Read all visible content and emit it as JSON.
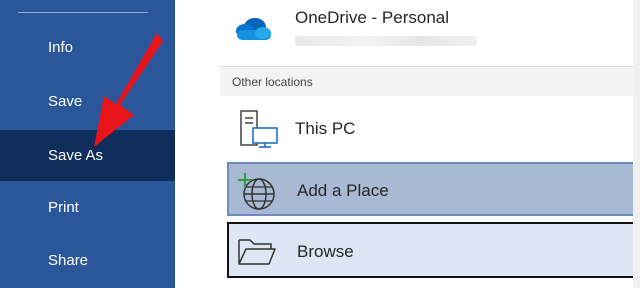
{
  "sidebar": {
    "items": [
      {
        "label": "Info"
      },
      {
        "label": "Save"
      },
      {
        "label": "Save As",
        "selected": true
      },
      {
        "label": "Print"
      },
      {
        "label": "Share"
      }
    ],
    "background": "#2b579a",
    "selected_background": "#0f2e5c"
  },
  "onedrive": {
    "title": "OneDrive - Personal",
    "icon": "onedrive-cloud-icon"
  },
  "other_locations": {
    "header": "Other locations",
    "items": [
      {
        "label": "This PC",
        "icon": "computer-icon"
      },
      {
        "label": "Add a Place",
        "icon": "globe-add-icon",
        "state": "hover"
      },
      {
        "label": "Browse",
        "icon": "folder-icon",
        "state": "focused"
      }
    ]
  },
  "annotation": {
    "icon": "red-arrow-icon",
    "color": "#e8141a"
  }
}
